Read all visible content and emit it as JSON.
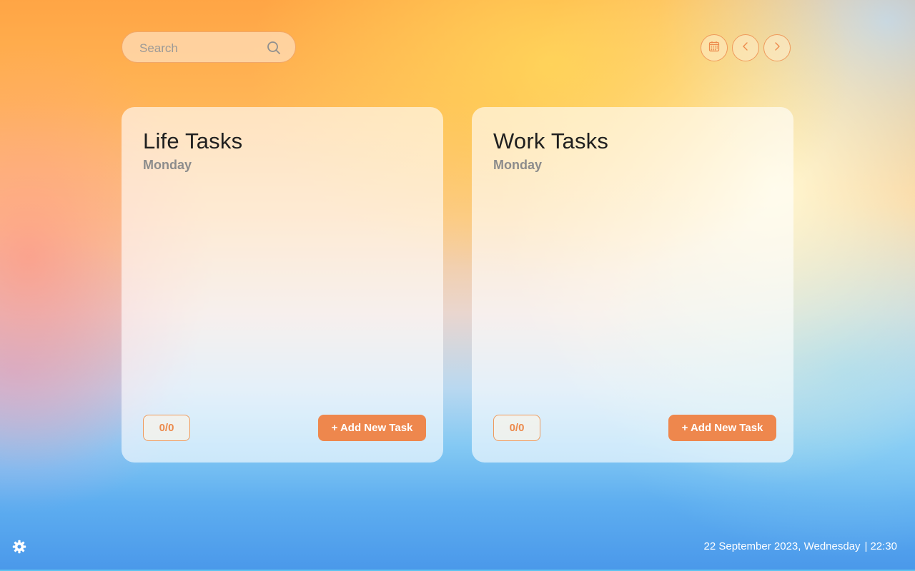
{
  "search": {
    "placeholder": "Search",
    "icon": "search-icon"
  },
  "nav": {
    "calendar_icon": "calendar-icon",
    "prev_icon": "chevron-left-icon",
    "next_icon": "chevron-right-icon"
  },
  "cards": [
    {
      "title": "Life Tasks",
      "day": "Monday",
      "count": "0/0",
      "add_label": "+ Add New Task"
    },
    {
      "title": "Work Tasks",
      "day": "Monday",
      "count": "0/0",
      "add_label": "+ Add New Task"
    }
  ],
  "footer": {
    "settings_icon": "gear-icon",
    "date": "22 September 2023, Wednesday",
    "separator": "|",
    "time": "22:30"
  },
  "colors": {
    "accent": "#ee874d",
    "accent_border": "#ef9a5c"
  }
}
